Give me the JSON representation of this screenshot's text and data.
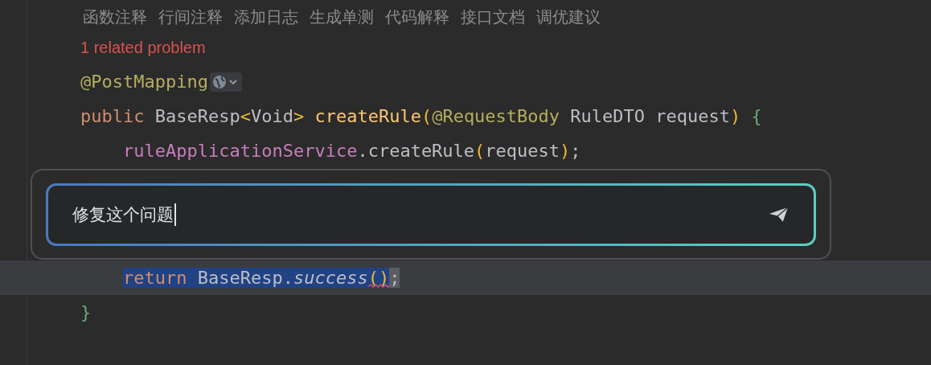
{
  "code_vision_actions": [
    {
      "label": "函数注释"
    },
    {
      "label": "行间注释"
    },
    {
      "label": "添加日志"
    },
    {
      "label": "生成单测"
    },
    {
      "label": "代码解释"
    },
    {
      "label": "接口文档"
    },
    {
      "label": "调优建议"
    }
  ],
  "problem_link": "1 related problem",
  "code_before": [
    {
      "inlay_hint": true,
      "tokens": [
        {
          "text": "@PostMapping",
          "kind": "annotation"
        }
      ]
    },
    {
      "tokens": [
        {
          "text": "public",
          "kind": "keyword"
        },
        {
          "text": " BaseResp",
          "kind": "plain"
        },
        {
          "text": "<",
          "kind": "bracket"
        },
        {
          "text": "Void",
          "kind": "plain"
        },
        {
          "text": ">",
          "kind": "bracket"
        },
        {
          "text": " createRule",
          "kind": "method"
        },
        {
          "text": "(",
          "kind": "bracket"
        },
        {
          "text": "@RequestBody",
          "kind": "annotation"
        },
        {
          "text": " RuleDTO request",
          "kind": "plain"
        },
        {
          "text": ")",
          "kind": "bracket"
        },
        {
          "text": " {",
          "kind": "brace"
        }
      ],
      "children": [
        {
          "tokens": [
            {
              "text": "ruleApplicationService",
              "kind": "field"
            },
            {
              "text": ".createRule",
              "kind": "plain"
            },
            {
              "text": "(",
              "kind": "bracket"
            },
            {
              "text": "request",
              "kind": "plain"
            },
            {
              "text": ")",
              "kind": "bracket"
            },
            {
              "text": ";",
              "kind": "plain"
            }
          ]
        }
      ]
    }
  ],
  "prompt": {
    "value": "修复这个问题"
  },
  "code_after": [
    {
      "current": true,
      "indented": true,
      "tokens": [
        {
          "text": "return",
          "kind": "keyword",
          "selected": true
        },
        {
          "text": " BaseResp.",
          "kind": "plain",
          "selected": true
        },
        {
          "text": "success",
          "kind": "static",
          "selected": true
        },
        {
          "text": "()",
          "kind": "bracket",
          "selected": true,
          "error": true
        },
        {
          "text": ";",
          "kind": "plain",
          "selected": false,
          "caret": true
        }
      ]
    },
    {
      "tokens": [
        {
          "text": "}",
          "kind": "brace"
        }
      ]
    }
  ]
}
